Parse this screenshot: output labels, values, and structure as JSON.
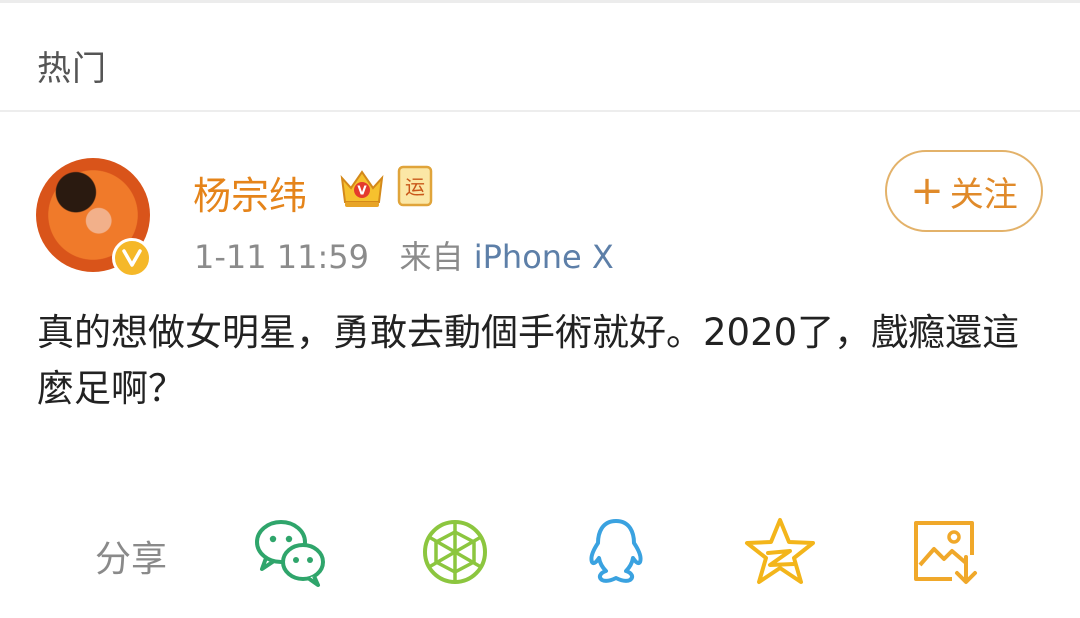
{
  "header": {
    "title": "热门"
  },
  "post": {
    "username": "杨宗纬",
    "badge_text": "运",
    "time": "1-11 11:59",
    "source_prefix": "来自",
    "source": "iPhone X",
    "follow_label": "关注",
    "text": "真的想做女明星，勇敢去動個手術就好。2020了，戲瘾還這麼足啊？"
  },
  "share": {
    "label": "分享",
    "icons": [
      "wechat-icon",
      "moments-icon",
      "qq-icon",
      "qzone-icon",
      "save-image-icon"
    ]
  },
  "colors": {
    "username": "#e5841a",
    "follow_border": "#e3b26a",
    "wechat": "#2fa56b",
    "moments": "#8cc63f",
    "qq": "#3aa2e0",
    "qzone": "#f3b51b",
    "save": "#f0a82a"
  }
}
